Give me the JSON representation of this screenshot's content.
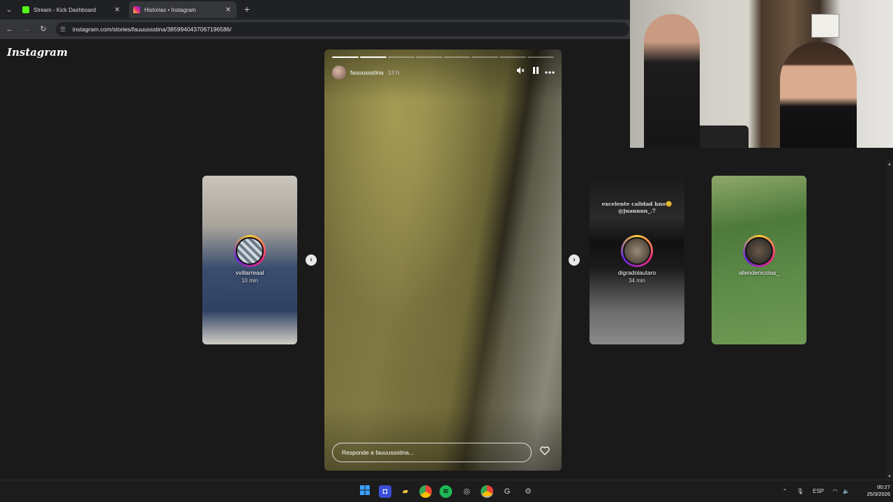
{
  "browser": {
    "tabs": [
      {
        "title": "Stream - Kick Dashboard",
        "favicon_color": "#53fc18",
        "active": false
      },
      {
        "title": "Historias • Instagram",
        "favicon_color": "#e1306c",
        "active": true
      }
    ],
    "url": "instagram.com/stories/fauuussstina/3859940437067196586/"
  },
  "instagram": {
    "logo": "Instagram",
    "main_story": {
      "username": "fauuussstina",
      "time": "13 h",
      "progress_segments": 8,
      "progress_completed": 2,
      "reply_placeholder": "Responde a fauuussstina..."
    },
    "side_stories": [
      {
        "username": "vvillarreaal",
        "time": "10 min"
      },
      {
        "username": "digradolautaro",
        "time": "34 min",
        "caption": "excelente calidad hno😊 @juannnn_.7"
      },
      {
        "username": "allendenicolas_",
        "time": ""
      }
    ]
  },
  "icons": {
    "mute": "speaker-muted-icon",
    "pause": "pause-icon",
    "more": "more-icon",
    "like": "heart-icon"
  },
  "taskbar": {
    "language": "ESP",
    "time": "00:27",
    "date": "25/3/2026"
  }
}
